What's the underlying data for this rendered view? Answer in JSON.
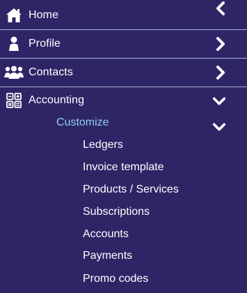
{
  "nav": {
    "collapse_icon": "chevron-left-icon",
    "items": [
      {
        "label": "Home",
        "icon": "home-icon"
      },
      {
        "label": "Profile",
        "icon": "user-icon"
      },
      {
        "label": "Contacts",
        "icon": "users-icon"
      },
      {
        "label": "Accounting",
        "icon": "grid-calculator-icon"
      }
    ],
    "accounting": {
      "sub_group_label": "Customize",
      "sub_items": [
        "Ledgers",
        "Invoice template",
        "Products / Services",
        "Subscriptions",
        "Accounts",
        "Payments",
        "Promo codes"
      ]
    }
  },
  "colors": {
    "background": "#2e2566",
    "text": "#ffffff",
    "sub_group_text": "#8fd0f0",
    "divider": "#aab0d0"
  }
}
